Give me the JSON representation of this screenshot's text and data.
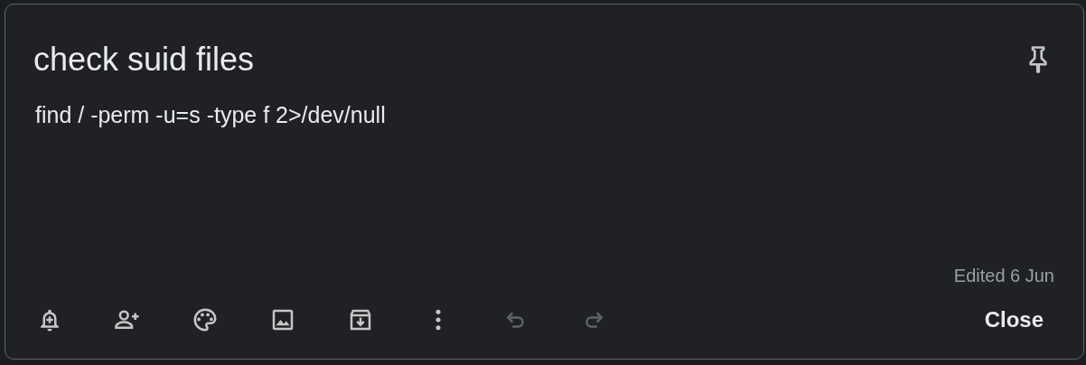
{
  "note": {
    "title": "check suid files",
    "body": "find / -perm -u=s -type f 2>/dev/null",
    "edited": "Edited 6 Jun",
    "pinned": false
  },
  "toolbar": [
    {
      "kind": "remind",
      "disabled": false
    },
    {
      "kind": "collaborator",
      "disabled": false
    },
    {
      "kind": "palette",
      "disabled": false
    },
    {
      "kind": "image",
      "disabled": false
    },
    {
      "kind": "archive",
      "disabled": false
    },
    {
      "kind": "more",
      "disabled": false
    },
    {
      "kind": "undo",
      "disabled": true
    },
    {
      "kind": "redo",
      "disabled": true
    }
  ],
  "close_button": "Close"
}
